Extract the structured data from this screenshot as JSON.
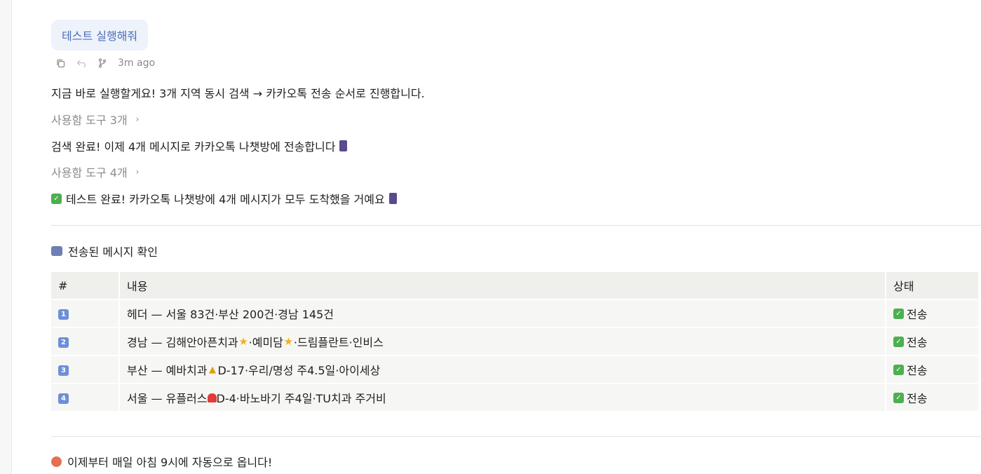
{
  "user_message": "테스트 실행해줘",
  "meta": {
    "timestamp": "3m ago",
    "icons": [
      "copy-icon",
      "undo-icon",
      "branch-icon"
    ]
  },
  "assistant": {
    "line1": "지금 바로 실행할게요! 3개 지역 동시 검색 → 카카오톡 전송 순서로 진행합니다.",
    "tools1": "사용함 도구 3개",
    "line2": "검색 완료! 이제 4개 메시지로 카카오톡 나챗방에 전송합니다",
    "tools2": "사용함 도구 4개",
    "line3": "테스트 완료! 카카오톡 나챗방에 4개 메시지가 모두 도착했을 거예요",
    "chevron": "›"
  },
  "section": {
    "title": "전송된 메시지 확인"
  },
  "table": {
    "headers": [
      "#",
      "내용",
      "상태"
    ],
    "rows": [
      {
        "num": "1",
        "content_a": "헤더 — 서울 83건·부산 200건·경남 145건",
        "content_b": "",
        "content_c": "",
        "status": "전송"
      },
      {
        "num": "2",
        "content_a": "경남 — 김해안아픈치과",
        "content_b": "·예미담",
        "content_c": "·드림플란트·인비스",
        "status": "전송"
      },
      {
        "num": "3",
        "content_a": "부산 — 예바치과",
        "content_b": " D-17·우리/명성 주4.5일·아이세상",
        "content_c": "",
        "status": "전송"
      },
      {
        "num": "4",
        "content_a": "서울 — 유플러스",
        "content_b": " D-4·바노바기 주4일·TU치과 주거비",
        "content_c": "",
        "status": "전송"
      }
    ]
  },
  "footer": "이제부터 매일 아침 9시에 자동으로 옵니다!",
  "colors": {
    "bubble_bg": "#eef2fb",
    "bubble_text": "#4d6fb8",
    "check_green": "#4caf50"
  }
}
